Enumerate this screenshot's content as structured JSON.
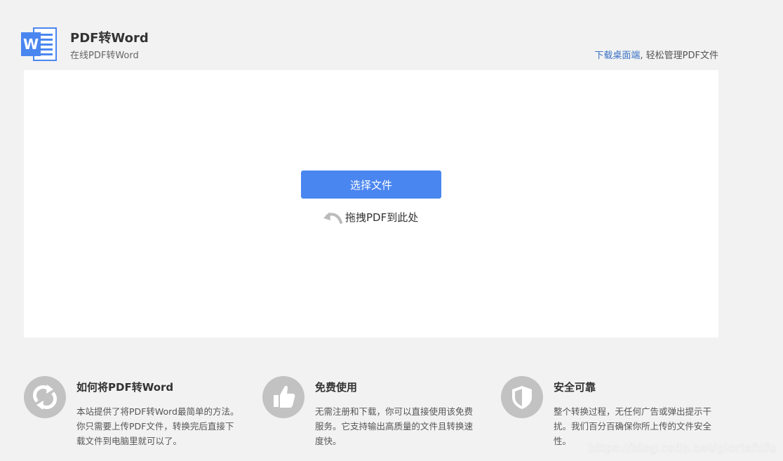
{
  "header": {
    "logo_letter": "W",
    "title": "PDF转Word",
    "subtitle": "在线PDF转Word",
    "desktop_link": "下载桌面端",
    "desktop_suffix": ", 轻松管理PDF文件"
  },
  "upload": {
    "choose_button": "选择文件",
    "drag_hint": "拖拽PDF到此处"
  },
  "features": [
    {
      "icon": "refresh-icon",
      "title": "如何将PDF转Word",
      "desc": "本站提供了将PDF转Word最简单的方法。你只需要上传PDF文件，转换完后直接下载文件到电脑里就可以了。"
    },
    {
      "icon": "thumbs-up-icon",
      "title": "免费使用",
      "desc": "无需注册和下载，你可以直接使用该免费服务。它支持输出高质量的文件且转换速度快。"
    },
    {
      "icon": "shield-icon",
      "title": "安全可靠",
      "desc": "整个转换过程，无任何广告或弹出提示干扰。我们百分百确保你所上传的文件安全性。"
    }
  ],
  "watermark": "https://blog.csdn.net/gloriafufu",
  "colors": {
    "primary_button": "#4a86f0",
    "link": "#3a72c4",
    "background": "#f2f2f2",
    "icon_circle": "#c2c2c2"
  }
}
